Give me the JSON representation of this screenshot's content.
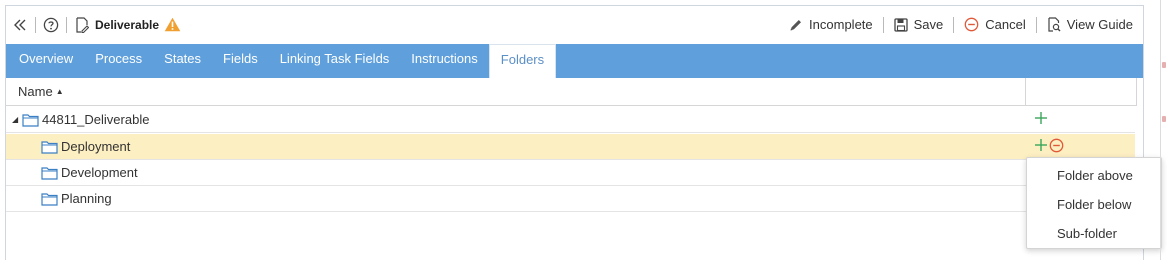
{
  "toolbar": {
    "collapse_icon": "double-chevron-left-icon",
    "help_icon": "question-circle-icon",
    "doc_icon": "document-edit-icon",
    "title": "Deliverable",
    "warning_icon": "warning-triangle-icon",
    "incomplete_label": "Incomplete",
    "save_label": "Save",
    "cancel_label": "Cancel",
    "guide_label": "View Guide",
    "colors": {
      "warning": "#f0a030",
      "cancel": "#e05a3a"
    }
  },
  "tabs": [
    {
      "label": "Overview"
    },
    {
      "label": "Process"
    },
    {
      "label": "States"
    },
    {
      "label": "Fields"
    },
    {
      "label": "Linking Task Fields"
    },
    {
      "label": "Instructions"
    },
    {
      "label": "Folders",
      "active": true
    }
  ],
  "grid": {
    "column_name": "Name",
    "sort": "ascending",
    "rows": [
      {
        "name": "44811_Deliverable",
        "expanded": true,
        "level": 0,
        "actions": [
          "add"
        ]
      },
      {
        "name": "Deployment",
        "level": 1,
        "selected": true,
        "actions": [
          "add",
          "remove"
        ]
      },
      {
        "name": "Development",
        "level": 1
      },
      {
        "name": "Planning",
        "level": 1
      }
    ]
  },
  "context_menu": {
    "items": [
      {
        "label": "Folder above"
      },
      {
        "label": "Folder below"
      },
      {
        "label": "Sub-folder"
      }
    ]
  },
  "colors": {
    "tab_bar": "#5fa0dc",
    "selected_row": "#fcefc2",
    "add": "#3aa65a",
    "remove": "#e05a3a",
    "folder": "#3b7fc4"
  }
}
